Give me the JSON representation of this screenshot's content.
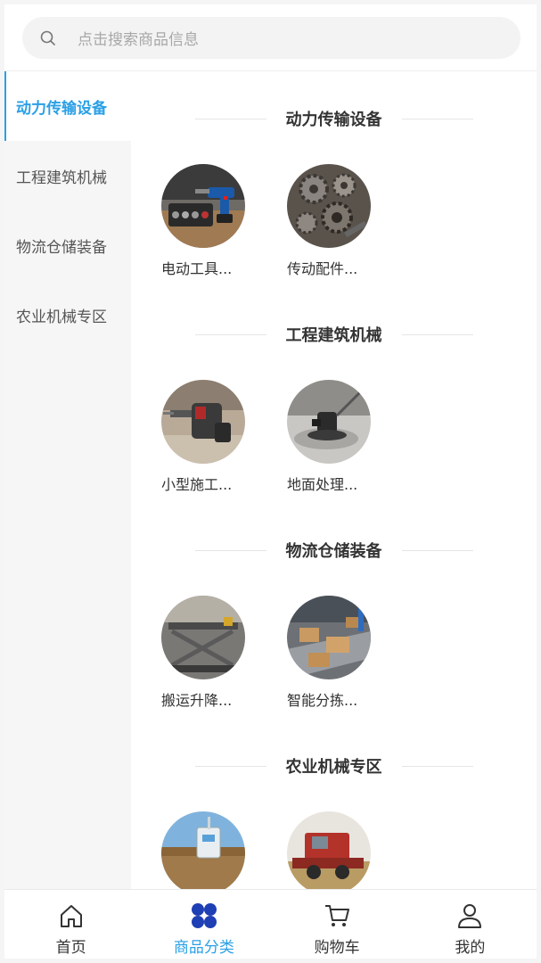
{
  "search": {
    "placeholder": "点击搜索商品信息"
  },
  "sidebar": {
    "items": [
      {
        "label": "动力传输设备",
        "active": true
      },
      {
        "label": "工程建筑机械",
        "active": false
      },
      {
        "label": "物流仓储装备",
        "active": false
      },
      {
        "label": "农业机械专区",
        "active": false
      }
    ]
  },
  "sections": [
    {
      "title": "动力传输设备",
      "items": [
        {
          "label": "电动工具...",
          "icon": "power-drill-photo"
        },
        {
          "label": "传动配件...",
          "icon": "gears-photo"
        }
      ]
    },
    {
      "title": "工程建筑机械",
      "items": [
        {
          "label": "小型施工...",
          "icon": "rotary-hammer-photo"
        },
        {
          "label": "地面处理...",
          "icon": "floor-machine-photo"
        }
      ]
    },
    {
      "title": "物流仓储装备",
      "items": [
        {
          "label": "搬运升降...",
          "icon": "scissor-lift-photo"
        },
        {
          "label": "智能分拣...",
          "icon": "conveyor-sorting-photo"
        }
      ]
    },
    {
      "title": "农业机械专区",
      "items": [
        {
          "label": "",
          "icon": "farm-device-photo"
        },
        {
          "label": "",
          "icon": "harvester-photo"
        }
      ]
    }
  ],
  "tabbar": {
    "tabs": [
      {
        "label": "首页",
        "icon": "home-icon",
        "active": false
      },
      {
        "label": "商品分类",
        "icon": "category-icon",
        "active": true
      },
      {
        "label": "购物车",
        "icon": "cart-icon",
        "active": false
      },
      {
        "label": "我的",
        "icon": "user-icon",
        "active": false
      }
    ]
  },
  "colors": {
    "accent": "#2aa0e6",
    "category_icon": "#1f3fb4"
  }
}
